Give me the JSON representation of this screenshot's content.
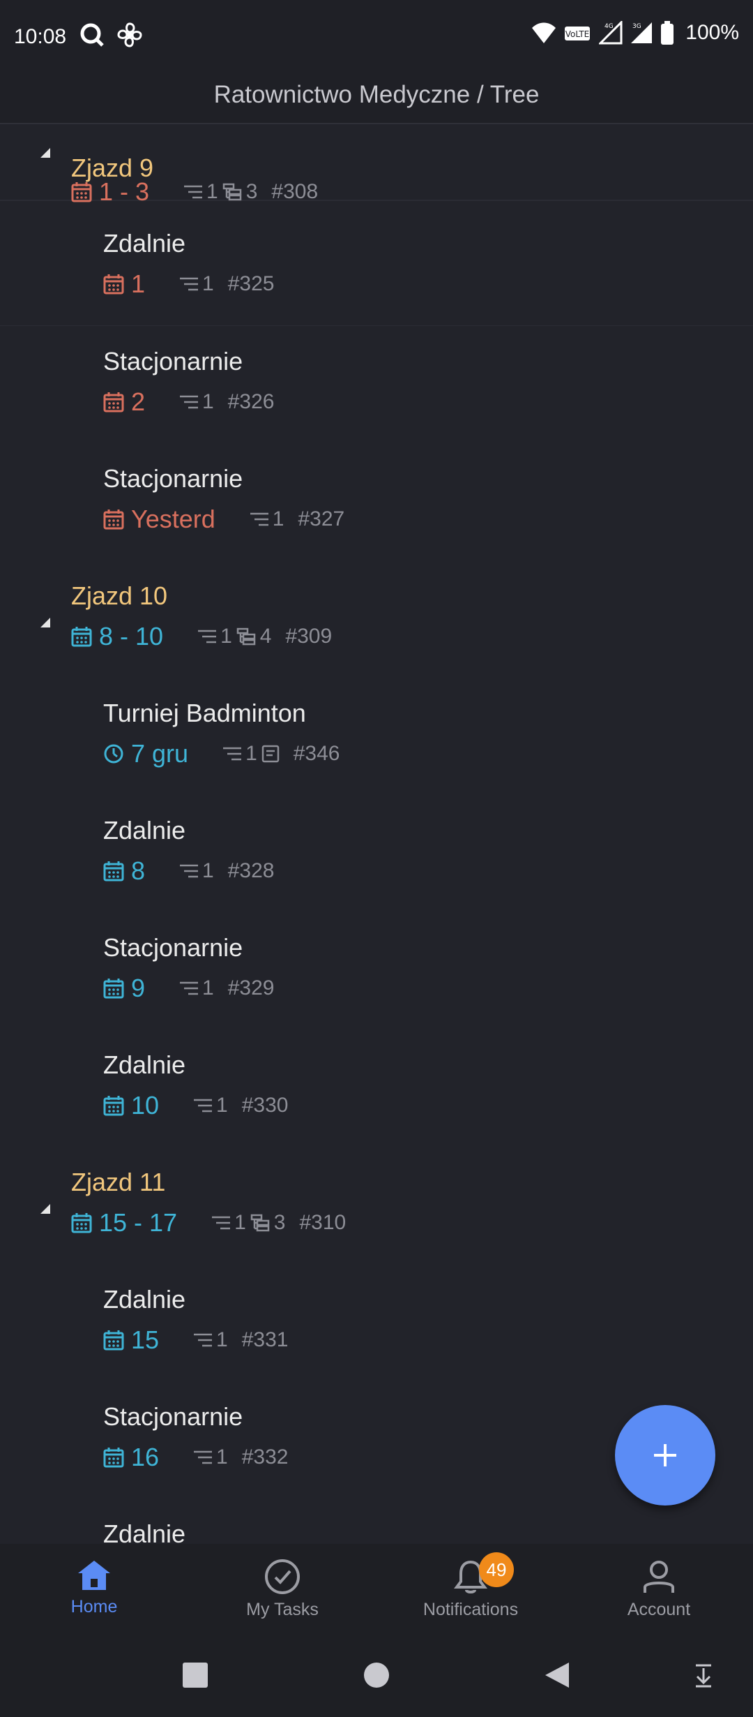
{
  "status_bar": {
    "time": "10:08",
    "battery": "100%"
  },
  "header": {
    "title": "Ratownictwo Medyczne / Tree"
  },
  "rows": [
    {
      "title": "Zjazd 9",
      "date": "1 - 3",
      "subtasks": "1",
      "children": "3",
      "id": "#308"
    },
    {
      "title": "Zdalnie",
      "date": "1",
      "subtasks": "1",
      "id": "#325"
    },
    {
      "title": "Stacjonarnie",
      "date": "2",
      "subtasks": "1",
      "id": "#326"
    },
    {
      "title": "Stacjonarnie",
      "date": "Yesterd",
      "subtasks": "1",
      "id": "#327"
    },
    {
      "title": "Zjazd 10",
      "date": "8 - 10",
      "subtasks": "1",
      "children": "4",
      "id": "#309"
    },
    {
      "title": "Turniej Badminton",
      "date": "7 gru",
      "subtasks": "1",
      "id": "#346"
    },
    {
      "title": "Zdalnie",
      "date": "8",
      "subtasks": "1",
      "id": "#328"
    },
    {
      "title": "Stacjonarnie",
      "date": "9",
      "subtasks": "1",
      "id": "#329"
    },
    {
      "title": "Zdalnie",
      "date": "10",
      "subtasks": "1",
      "id": "#330"
    },
    {
      "title": "Zjazd 11",
      "date": "15 - 17",
      "subtasks": "1",
      "children": "3",
      "id": "#310"
    },
    {
      "title": "Zdalnie",
      "date": "15",
      "subtasks": "1",
      "id": "#331"
    },
    {
      "title": "Stacjonarnie",
      "date": "16",
      "subtasks": "1",
      "id": "#332"
    },
    {
      "title": "Zdalnie"
    }
  ],
  "fab": {
    "label": "+"
  },
  "bottom_nav": {
    "home": "Home",
    "tasks": "My Tasks",
    "notifications": "Notifications",
    "notifications_badge": "49",
    "account": "Account"
  },
  "colors": {
    "accent": "#5b8cf5",
    "overdue": "#d9705e",
    "upcoming": "#3fb4d6",
    "group_title": "#f2c77d",
    "badge": "#f08a1a"
  }
}
